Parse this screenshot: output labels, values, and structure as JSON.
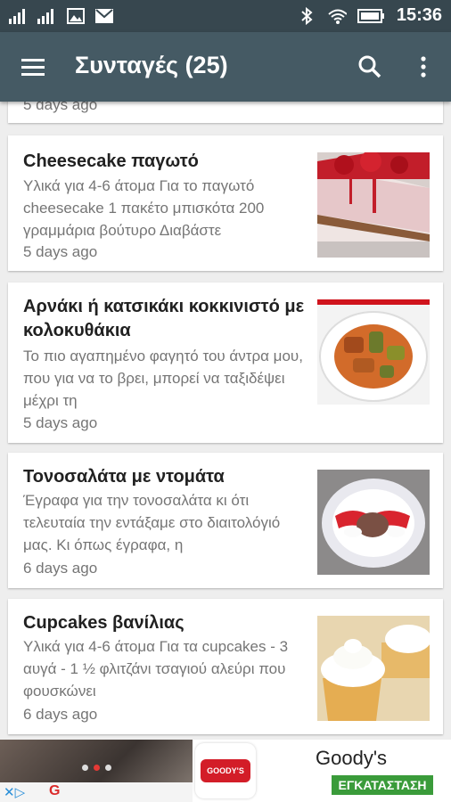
{
  "status_bar": {
    "time": "15:36"
  },
  "app_bar": {
    "title": "Συνταγές (25)"
  },
  "recipes": [
    {
      "age": "5 days ago"
    },
    {
      "title": "Cheesecake παγωτό",
      "description": "Υλικά για 4-6 άτομα Για το παγωτό cheesecake 1 πακέτο μπισκότα 200 γραμμάρια βούτυρο Διαβάστε",
      "age": "5 days ago"
    },
    {
      "title": "Αρνάκι ή κατσικάκι κοκκινιστό με κολοκυθάκια",
      "description": "Το πιο αγαπημένο φαγητό του άντρα μου, που για να το βρει, μπορεί να ταξιδέψει μέχρι τη",
      "age": "5 days ago"
    },
    {
      "title": "Τονοσαλάτα με ντομάτα",
      "description": "Έγραφα για την τονοσαλάτα κι ότι τελευταία την εντάξαμε στο διαιτολόγιό μας. Κι όπως έγραφα, η",
      "age": "6 days ago"
    },
    {
      "title": "Cupcakes βανίλιας",
      "description": "Υλικά για 4-6 άτομα Για τα cupcakes - 3 αυγά - 1 ½ φλιτζάνι τσαγιού αλεύρι που φουσκώνει",
      "age": "6 days ago"
    }
  ],
  "ad": {
    "logo_text": "GOODY'S",
    "brand": "Goody's",
    "install_label": "ΕΓΚΑΤΑΣΤΑΣΗ"
  },
  "colors": {
    "status_bar": "#37474f",
    "app_bar": "#455a64",
    "install": "#3a9b3a"
  }
}
